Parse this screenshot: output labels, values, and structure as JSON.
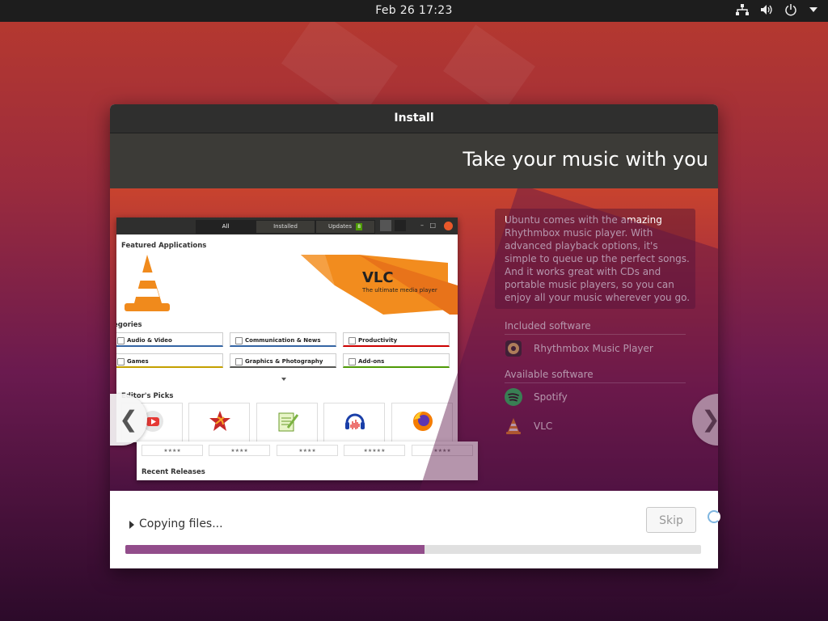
{
  "topbar": {
    "clock": "Feb 26  17:23",
    "icons": [
      "network-icon",
      "volume-icon",
      "power-icon",
      "dropdown-arrow-icon"
    ]
  },
  "window": {
    "title": "Install",
    "slide_heading": "Take your music with you",
    "description": "Ubuntu comes with the amazing Rhythmbox music player. With advanced playback options, it's simple to queue up the perfect songs. And it works great with CDs and portable music players, so you can enjoy all your music wherever you go.",
    "included_label": "Included software",
    "included": [
      {
        "name": "Rhythmbox Music Player",
        "icon": "rhythmbox-icon"
      }
    ],
    "available_label": "Available software",
    "available": [
      {
        "name": "Spotify",
        "icon": "spotify-icon"
      },
      {
        "name": "VLC",
        "icon": "vlc-icon"
      }
    ],
    "prev_arrow": "❮",
    "next_arrow": "❯",
    "status_text": "Copying files...",
    "skip_label": "Skip",
    "progress": 0.52
  },
  "mini_software": {
    "tabs": [
      "All",
      "Installed",
      "Updates"
    ],
    "updates_badge": "8",
    "featured_title": "Featured Applications",
    "banner_title": "VLC",
    "banner_subtitle": "The ultimate media player",
    "categories_title": "egories",
    "categories": [
      "Audio & Video",
      "Communication & News",
      "Productivity",
      "Games",
      "Graphics & Photography",
      "Add-ons"
    ],
    "editors_title": "Editor's Picks",
    "picks_labels": [
      "youtube-dl",
      "OpenRA",
      "Notepad-Plus...",
      "Audacity",
      "Firefox"
    ],
    "stars": "★★★★",
    "stars5": "★★★★★",
    "recent_title": "Recent Releases"
  },
  "colors": {
    "accent_progress": "#924d8b",
    "titlebar": "#2f2f2e",
    "heading_band": "#3c3b37"
  }
}
